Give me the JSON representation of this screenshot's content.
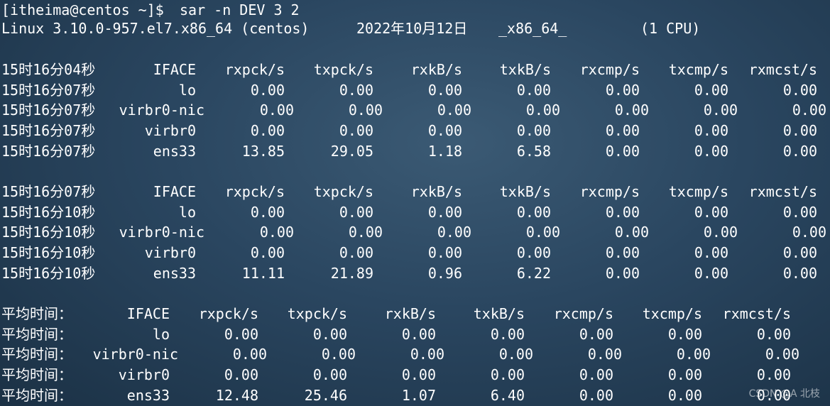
{
  "terminal": {
    "prompt": "[itheima@centos ~]$ ",
    "command": "sar -n DEV 3 2",
    "sysinfo": {
      "kernel": "Linux 3.10.0-957.el7.x86_64 (centos)",
      "date": "2022年10月12日",
      "arch": "_x86_64_",
      "cpu": "(1 CPU)"
    },
    "blocks": [
      {
        "header": [
          "15时16分04秒",
          "IFACE",
          "rxpck/s",
          "txpck/s",
          "rxkB/s",
          "txkB/s",
          "rxcmp/s",
          "txcmp/s",
          "rxmcst/s"
        ],
        "rows": [
          [
            "15时16分07秒",
            "lo",
            "0.00",
            "0.00",
            "0.00",
            "0.00",
            "0.00",
            "0.00",
            "0.00"
          ],
          [
            "15时16分07秒",
            "virbr0-nic",
            "0.00",
            "0.00",
            "0.00",
            "0.00",
            "0.00",
            "0.00",
            "0.00"
          ],
          [
            "15时16分07秒",
            "virbr0",
            "0.00",
            "0.00",
            "0.00",
            "0.00",
            "0.00",
            "0.00",
            "0.00"
          ],
          [
            "15时16分07秒",
            "ens33",
            "13.85",
            "29.05",
            "1.18",
            "6.58",
            "0.00",
            "0.00",
            "0.00"
          ]
        ]
      },
      {
        "header": [
          "15时16分07秒",
          "IFACE",
          "rxpck/s",
          "txpck/s",
          "rxkB/s",
          "txkB/s",
          "rxcmp/s",
          "txcmp/s",
          "rxmcst/s"
        ],
        "rows": [
          [
            "15时16分10秒",
            "lo",
            "0.00",
            "0.00",
            "0.00",
            "0.00",
            "0.00",
            "0.00",
            "0.00"
          ],
          [
            "15时16分10秒",
            "virbr0-nic",
            "0.00",
            "0.00",
            "0.00",
            "0.00",
            "0.00",
            "0.00",
            "0.00"
          ],
          [
            "15时16分10秒",
            "virbr0",
            "0.00",
            "0.00",
            "0.00",
            "0.00",
            "0.00",
            "0.00",
            "0.00"
          ],
          [
            "15时16分10秒",
            "ens33",
            "11.11",
            "21.89",
            "0.96",
            "6.22",
            "0.00",
            "0.00",
            "0.00"
          ]
        ]
      },
      {
        "header": [
          "平均时间：",
          "IFACE",
          "rxpck/s",
          "txpck/s",
          "rxkB/s",
          "txkB/s",
          "rxcmp/s",
          "txcmp/s",
          "rxmcst/s"
        ],
        "rows": [
          [
            "平均时间：",
            "lo",
            "0.00",
            "0.00",
            "0.00",
            "0.00",
            "0.00",
            "0.00",
            "0.00"
          ],
          [
            "平均时间：",
            "virbr0-nic",
            "0.00",
            "0.00",
            "0.00",
            "0.00",
            "0.00",
            "0.00",
            "0.00"
          ],
          [
            "平均时间：",
            "virbr0",
            "0.00",
            "0.00",
            "0.00",
            "0.00",
            "0.00",
            "0.00",
            "0.00"
          ],
          [
            "平均时间：",
            "ens33",
            "12.48",
            "25.46",
            "1.07",
            "6.40",
            "0.00",
            "0.00",
            "0.00"
          ]
        ]
      }
    ]
  },
  "watermark": "CSDN @A 北枝"
}
